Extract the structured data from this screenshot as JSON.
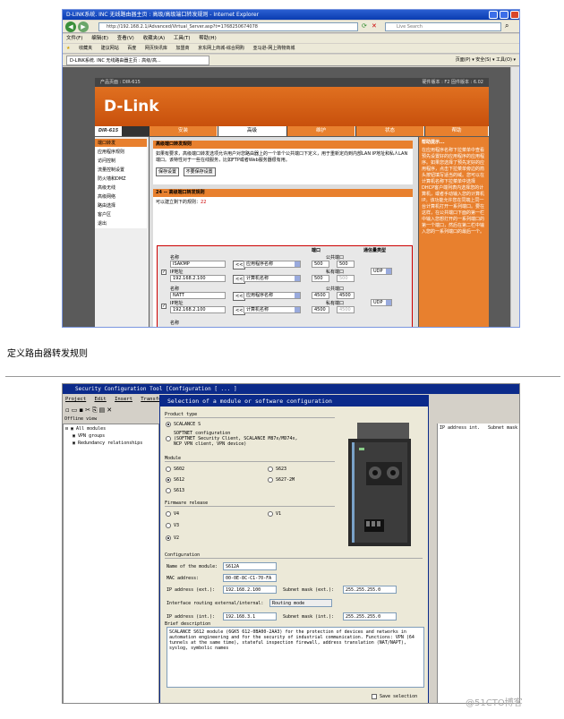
{
  "ie": {
    "title": "D-LINK系统. INC 无线路由器主页 : 高级/高级端口转发规则 - Internet Explorer",
    "address": "http://192.168.2.1/Advanced/Virtual_Server.asp?t=1768250674078",
    "live_search": "Live Search",
    "menu": [
      "文件(F)",
      "编辑(E)",
      "查看(V)",
      "收藏夹(A)",
      "工具(T)",
      "帮助(H)"
    ],
    "favorites": [
      "收藏夹",
      "建议网站",
      "百度",
      "网页快讯库",
      "加盟商",
      "京东网上商城-综合网购",
      "亚马逊-网上购物商城"
    ],
    "tab": "D-LINK系统. INC 无线路由器主页 : 高级/高...",
    "tools": "页面(P) ▾  安全(S) ▾  工具(O) ▾"
  },
  "router": {
    "product_page": "产品页面 : DIR-615",
    "hw_fw": "硬件版本 : F2   固件版本 : 6.02",
    "logo": "D-Link",
    "model": "DIR-615",
    "tabs": [
      "安装",
      "高级",
      "维护",
      "状态",
      "帮助"
    ],
    "side": [
      "端口转发",
      "应用程序规则",
      "访问控制",
      "流量控制设置",
      "防火墙和DMZ",
      "高级无线",
      "高级网络",
      "路由选择",
      "客户区",
      "退出"
    ],
    "section_title": "高级端口转发规则",
    "section_text": "如果有要求，高级端口转发选项允许用户对您路由器上的一个单个公共端口下定义，用于重新定向到内部LAN IP地址和私人LAN端口。该特性对于一些在线服务，比如FTP或者Web服务器很有用。",
    "save_btn": "保存设置",
    "nosave_btn": "不要保存设置",
    "rules_title": "24 -- 高级端口转发规则",
    "rules_count_label": "可以建立剩下的规则：",
    "rules_count": "22",
    "col_port": "端口",
    "col_type": "通信量类型",
    "name_label": "名称",
    "ip_label": "IP地址",
    "public_port": "公共端口",
    "private_port": "私有端口",
    "app_name": "应用程序名称",
    "computer_name": "计算机名称",
    "rules": [
      {
        "name": "ISAKMP",
        "ip": "192.168.2.100",
        "pub1": "500",
        "pub2": "500",
        "priv": "500",
        "priv2": "500",
        "type": "UDP"
      },
      {
        "name": "NATT",
        "ip": "192.168.2.100",
        "pub1": "4500",
        "pub2": "4500",
        "priv": "4500",
        "priv2": "4500",
        "type": "UDP"
      }
    ],
    "help_title": "帮助提示...",
    "help_text": "在应用程序名称下拉菜单中查看预先设置好的应用程序的应用程序。如果您选择了预先定好的应用程序，点击下拉菜单旁边的箭头按钮填写适当的域。您可以在计算机名称下拉菜单中选择DHCP客户端列表内选择您的计算机，或者手动输入您的计算机IP。该功能允许您在同端上同一台计算机打开一系列端口。要在这样，在公共端口下面的第一栏中输入您想打开的一系列端口的第一个端口，然后在第二栏中输入您的一系列端口的最后一个。"
  },
  "caption": "定义路由器转发规则",
  "sct": {
    "title": "Security Configuration Tool  [Configuration [ ... ]",
    "menu": [
      "Project",
      "Edit",
      "Insert",
      "Transfer"
    ],
    "offline_view": "Offline view",
    "tree": [
      "All modules",
      "VPN groups",
      "Redundancy relationships"
    ],
    "col_ip": "IP address int.",
    "col_mask": "Subnet mask"
  },
  "dialog": {
    "title": "Selection of a module or software configuration",
    "product_type_label": "Product type",
    "product_opts": [
      "SCALANCE S",
      "SOFTNET configuration\n(SOFTNET Security Client, SCALANCE M87x/MD74x,\nNCP VPN client, VPN device)"
    ],
    "module_label": "Module",
    "modules": [
      "S602",
      "S612",
      "S613",
      "S623",
      "S627-2M"
    ],
    "firmware_label": "Firmware release",
    "firmwares": [
      "V4",
      "V3",
      "V2",
      "V1"
    ],
    "config_label": "Configuration",
    "name_label": "Name of the module:",
    "name_value": "S612A",
    "mac_label": "MAC address:",
    "mac_value": "00-0E-8C-C1-70-FA",
    "ip_ext_label": "IP address (ext.):",
    "ip_ext_value": "192.168.2.100",
    "mask_ext_label": "Subnet mask (ext.):",
    "mask_ext_value": "255.255.255.0",
    "routing_label": "Interface routing external/internal:",
    "routing_value": "Routing mode",
    "ip_int_label": "IP address (int.):",
    "ip_int_value": "192.168.3.1",
    "mask_int_label": "Subnet mask (int.):",
    "mask_int_value": "255.255.255.0",
    "brief_label": "Brief description",
    "brief_text": "SCALANCE S612 module (6GK5 612-0BA00-2AA3) for the protection of devices and networks in automation engineering and for the security of industrial communication. Functions: VPN (64 tunnels at the same time), stateful inspection firewall, address translation (NAT/NAPT), syslog, symbolic names",
    "save_selection": "Save selection"
  },
  "watermark": "@51CTO博客"
}
